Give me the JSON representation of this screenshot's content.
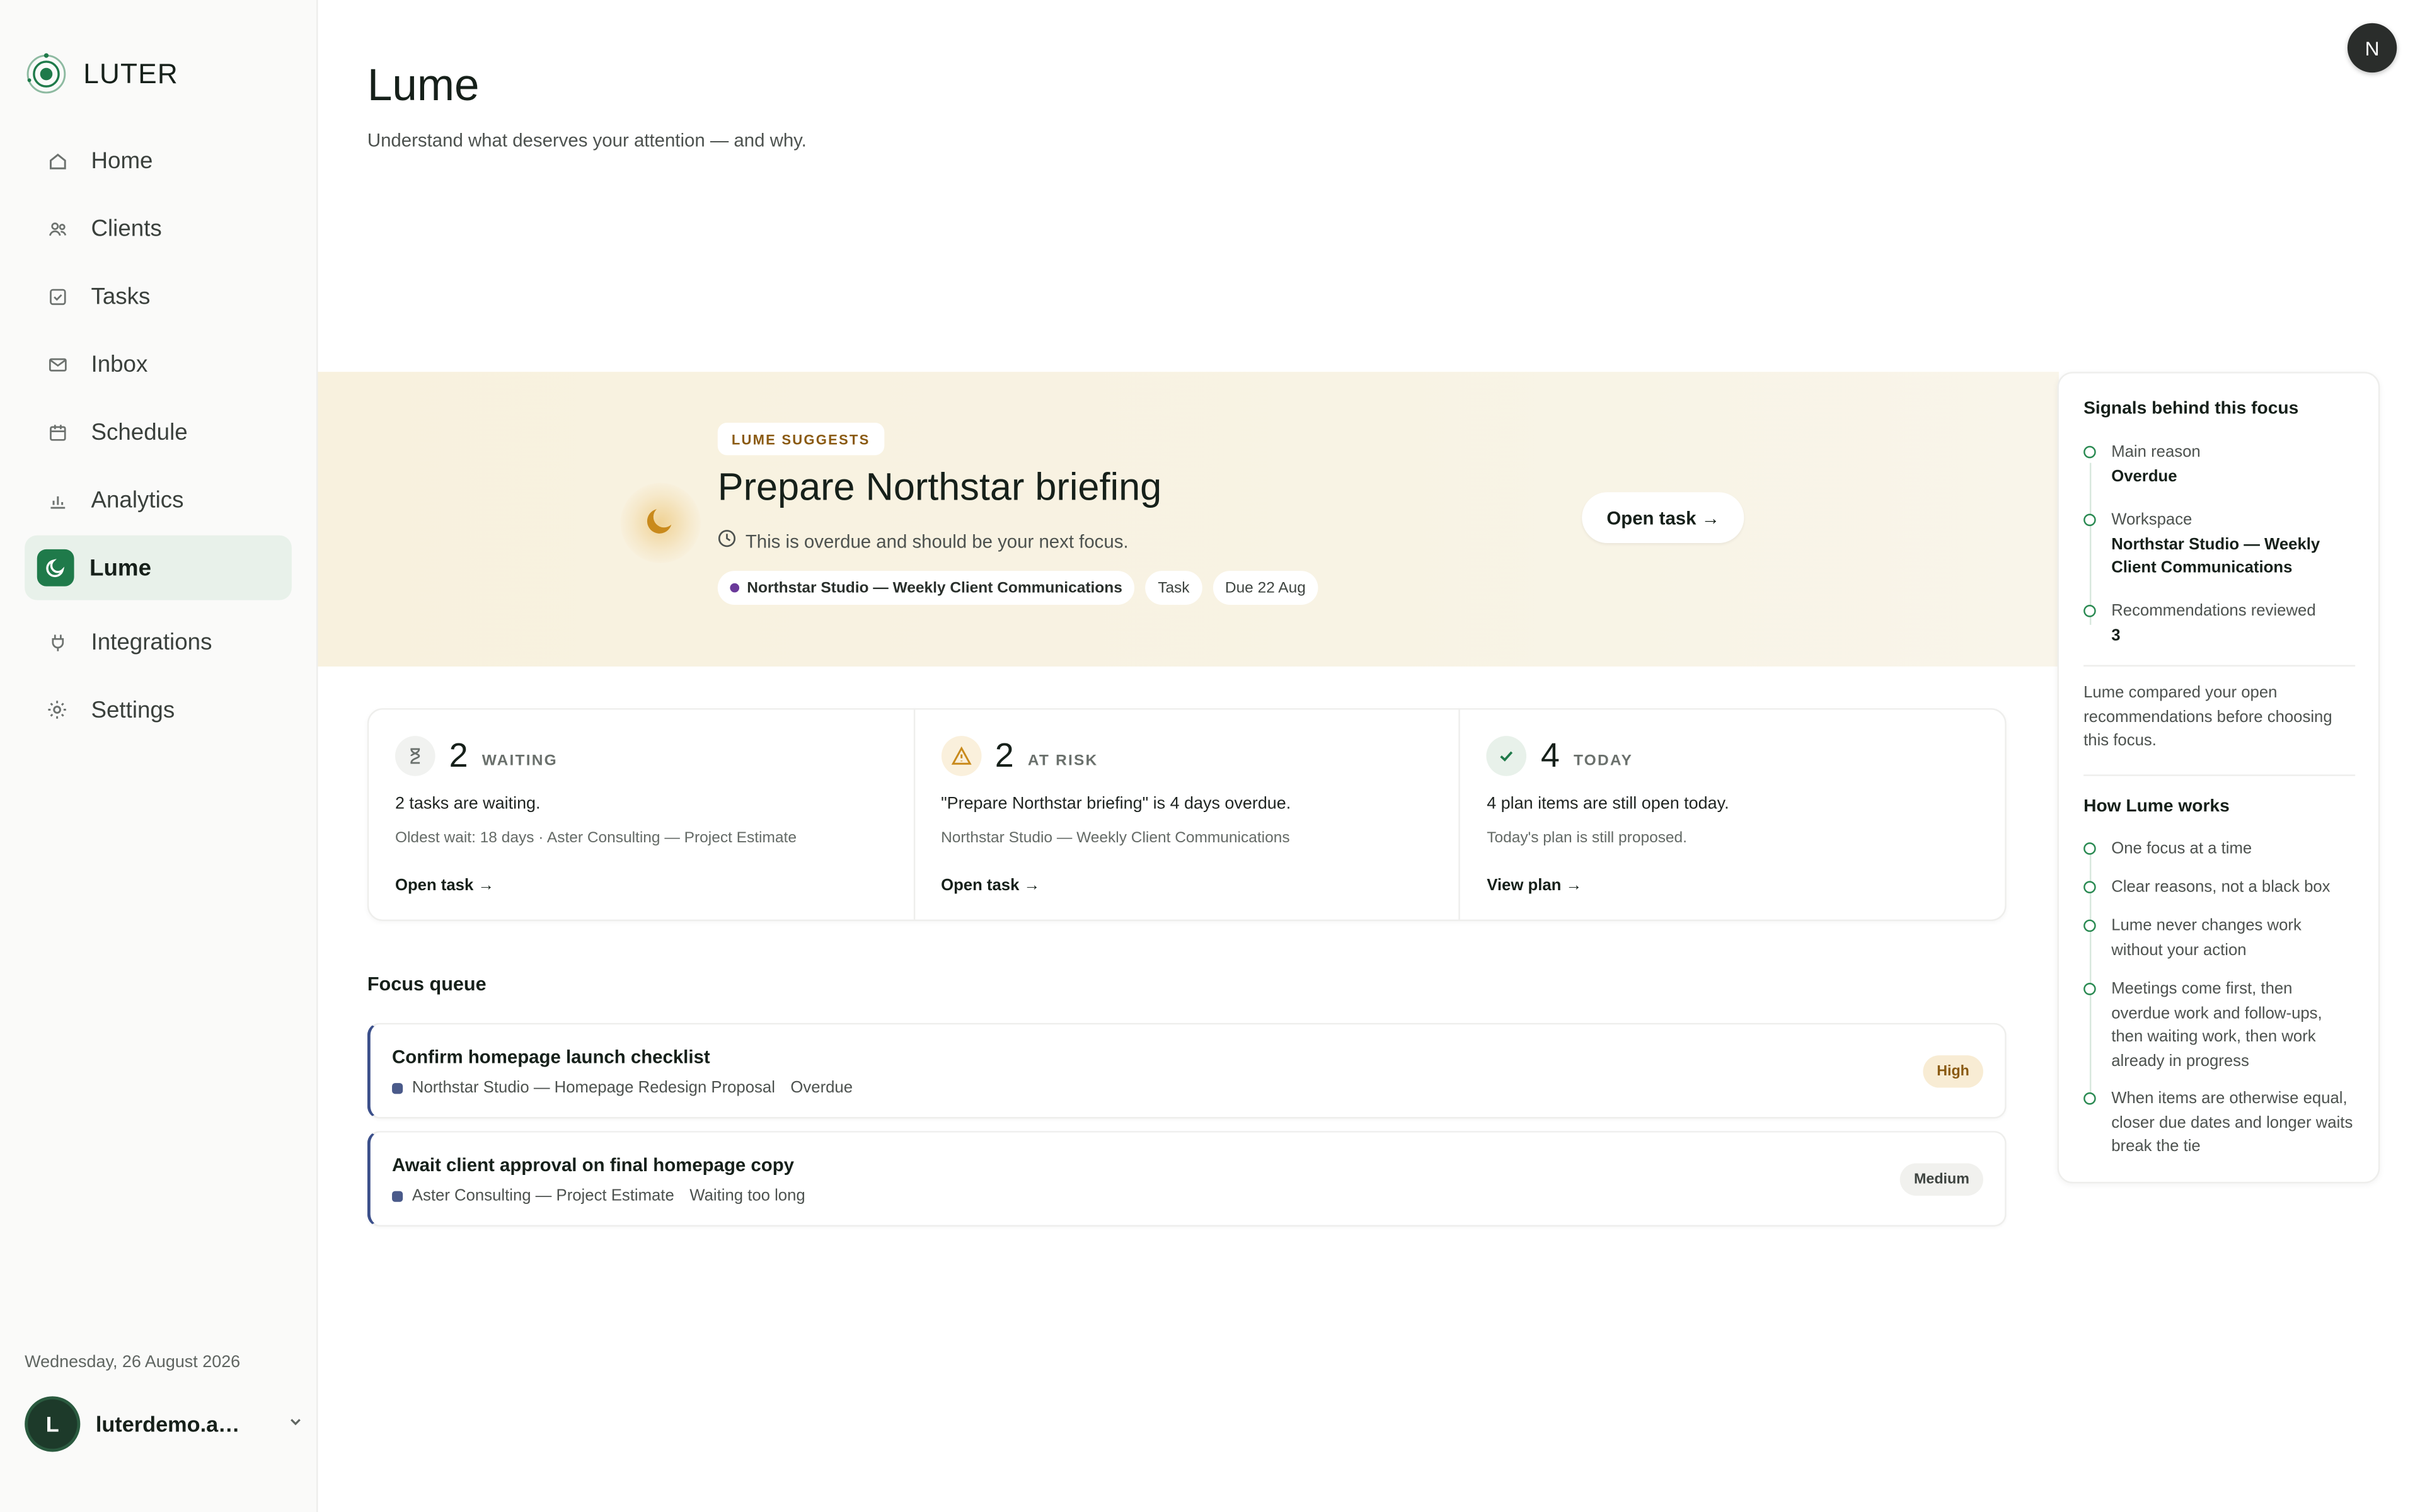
{
  "app": {
    "brand": "LUTER"
  },
  "sidebar": {
    "items": [
      {
        "label": "Home",
        "icon": "home-icon"
      },
      {
        "label": "Clients",
        "icon": "users-icon"
      },
      {
        "label": "Tasks",
        "icon": "check-square-icon"
      },
      {
        "label": "Inbox",
        "icon": "mail-icon"
      },
      {
        "label": "Schedule",
        "icon": "calendar-icon"
      },
      {
        "label": "Analytics",
        "icon": "bar-chart-icon"
      },
      {
        "label": "Lume",
        "icon": "moon-icon",
        "active": true
      },
      {
        "label": "Integrations",
        "icon": "plug-icon"
      },
      {
        "label": "Settings",
        "icon": "gear-icon"
      }
    ],
    "date": "Wednesday, 26 August 2026",
    "user": {
      "initial": "L",
      "email": "luterdemo.ap..."
    }
  },
  "header": {
    "title": "Lume",
    "subtitle": "Understand what deserves your attention — and why.",
    "avatar_initial": "N"
  },
  "hero": {
    "badge": "LUME SUGGESTS",
    "title": "Prepare Northstar briefing",
    "reason": "This is overdue and should be your next focus.",
    "chips": [
      "Northstar Studio — Weekly Client Communications",
      "Task",
      "Due 22 Aug"
    ],
    "button": "Open task →"
  },
  "stats": [
    {
      "count": "2",
      "label": "WAITING",
      "main": "2 tasks are waiting.",
      "sub": "Oldest wait: 18 days · Aster Consulting — Project Estimate",
      "link": "Open task →",
      "icon": "hourglass-icon",
      "color": "#6a706c"
    },
    {
      "count": "2",
      "label": "AT RISK",
      "main": "\"Prepare Northstar briefing\" is 4 days overdue.",
      "sub": "Northstar Studio — Weekly Client Communications",
      "link": "Open task →",
      "icon": "warning-icon",
      "color": "#c98a1c"
    },
    {
      "count": "4",
      "label": "TODAY",
      "main": "4 plan items are still open today.",
      "sub": "Today's plan is still proposed.",
      "link": "View plan →",
      "icon": "check-icon",
      "color": "#1f7a4a"
    }
  ],
  "queue": {
    "title": "Focus queue",
    "items": [
      {
        "title": "Confirm homepage launch checklist",
        "workspace": "Northstar Studio — Homepage Redesign Proposal",
        "status": "Overdue",
        "priority": "High"
      },
      {
        "title": "Await client approval on final homepage copy",
        "workspace": "Aster Consulting — Project Estimate",
        "status": "Waiting too long",
        "priority": "Medium"
      }
    ]
  },
  "panel": {
    "signals_title": "Signals behind this focus",
    "signals": [
      {
        "label": "Main reason",
        "value": "Overdue"
      },
      {
        "label": "Workspace",
        "value": "Northstar Studio — Weekly Client Communications"
      },
      {
        "label": "Recommendations reviewed",
        "value": "3"
      }
    ],
    "note": "Lume compared your open recommendations before choosing this focus.",
    "how_title": "How Lume works",
    "how": [
      "One focus at a time",
      "Clear reasons, not a black box",
      "Lume never changes work without your action",
      "Meetings come first, then overdue work and follow-ups, then waiting work, then work already in progress",
      "When items are otherwise equal, closer due dates and longer waits break the tie"
    ]
  },
  "colors": {
    "accent": "#1f7a4a",
    "hero_bg": "#f8f1de",
    "warning": "#c98a1c",
    "queue_bar": "#3b4f8a"
  }
}
